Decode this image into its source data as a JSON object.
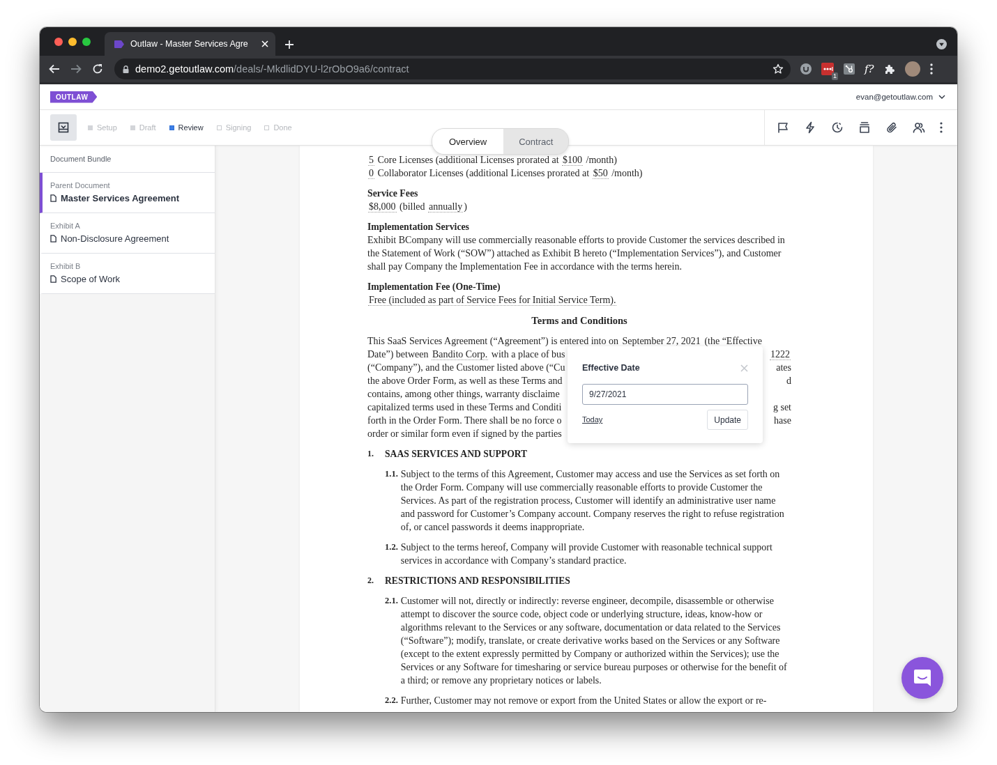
{
  "browser": {
    "tab_title": "Outlaw - Master Services Agre",
    "url_host": "demo2.getoutlaw.com",
    "url_path": "/deals/-MkdlidDYU-l2rObO9a6/contract",
    "extension_badge": "1",
    "extension_glyph": "f?"
  },
  "app": {
    "logo": "OUTLAW",
    "user_email": "evan@getoutlaw.com"
  },
  "steps": [
    {
      "label": "Setup",
      "completed": true,
      "selected": false
    },
    {
      "label": "Draft",
      "completed": true,
      "selected": false
    },
    {
      "label": "Review",
      "completed": false,
      "selected": true
    },
    {
      "label": "Signing",
      "completed": false,
      "selected": false
    },
    {
      "label": "Done",
      "completed": false,
      "selected": false
    }
  ],
  "view_tabs": [
    {
      "label": "Overview",
      "selected": true
    },
    {
      "label": "Contract",
      "selected": false
    }
  ],
  "sidebar": {
    "title": "Document Bundle",
    "items": [
      {
        "label": "Parent Document",
        "title": "Master Services Agreement",
        "selected": true
      },
      {
        "label": "Exhibit A",
        "title": "Non-Disclosure Agreement",
        "selected": false
      },
      {
        "label": "Exhibit B",
        "title": "Scope of Work",
        "selected": false
      }
    ]
  },
  "document": {
    "blocks": [
      {
        "kind": "lines",
        "lines": [
          [
            {
              "text": "5",
              "variable": true
            },
            {
              "text": " Core Licenses (additional Licenses prorated at ",
              "variable": false
            },
            {
              "text": "$100",
              "variable": true
            },
            {
              "text": " /month)",
              "variable": false
            }
          ],
          [
            {
              "text": "0",
              "variable": true
            },
            {
              "text": " Collaborator Licenses (additional Licenses prorated at ",
              "variable": false
            },
            {
              "text": "$50",
              "variable": true
            },
            {
              "text": " /month)",
              "variable": false
            }
          ]
        ]
      },
      {
        "kind": "heading",
        "text": "Service Fees"
      },
      {
        "kind": "lines",
        "lines": [
          [
            {
              "text": "$8,000",
              "variable": true
            },
            {
              "text": " (billed ",
              "variable": false
            },
            {
              "text": "annually",
              "variable": true
            },
            {
              "text": ")",
              "variable": false
            }
          ]
        ]
      },
      {
        "kind": "heading",
        "text": "Implementation Services"
      },
      {
        "kind": "paragraph",
        "text": "Exhibit BCompany will use commercially reasonable efforts to provide Customer the services described in the Statement of Work (“SOW”) attached as Exhibit B hereto (“Implementation Services”), and Customer shall pay Company the Implementation Fee in accordance with the terms herein."
      },
      {
        "kind": "heading",
        "text": "Implementation Fee (One-Time)"
      },
      {
        "kind": "lines",
        "lines": [
          [
            {
              "text": "Free (included as part of Service Fees for Initial Service Term).",
              "variable": true
            }
          ]
        ]
      },
      {
        "kind": "title",
        "text": "Terms and Conditions"
      },
      {
        "kind": "split_paragraph",
        "lines": [
          {
            "left": [
              {
                "text": "This SaaS Services Agreement (“Agreement”) is entered into on ",
                "variable": false
              },
              {
                "text": "September 27, 2021",
                "variable": true
              },
              {
                "text": " (the “Effective",
                "variable": false
              }
            ]
          },
          {
            "left": [
              {
                "text": "Date”) between ",
                "variable": false
              },
              {
                "text": "Bandito Corp.",
                "variable": true
              },
              {
                "text": " with a place of bus",
                "variable": false
              }
            ],
            "right": [
              {
                "text": "1222",
                "variable": true
              }
            ]
          },
          {
            "left": [
              {
                "text": "(“Company”), and the Customer listed above (“Cu",
                "variable": false
              }
            ],
            "right": [
              {
                "text": "ates",
                "variable": false
              }
            ]
          },
          {
            "left": [
              {
                "text": "the above Order Form, as well as these Terms and",
                "variable": false
              }
            ],
            "right": [
              {
                "text": "d",
                "variable": false
              }
            ]
          },
          {
            "left": [
              {
                "text": "contains, among other things, warranty disclaime",
                "variable": false
              }
            ]
          },
          {
            "left": [
              {
                "text": "capitalized terms used in these Terms and Conditi",
                "variable": false
              }
            ],
            "right": [
              {
                "text": "g set",
                "variable": false
              }
            ]
          },
          {
            "left": [
              {
                "text": "forth in the Order Form. There shall be no force o",
                "variable": false
              }
            ],
            "right": [
              {
                "text": "hase",
                "variable": false
              }
            ]
          },
          {
            "left": [
              {
                "text": "order or similar form even if signed by the parties",
                "variable": false
              }
            ]
          }
        ]
      },
      {
        "kind": "section",
        "number": "1.",
        "text": "SAAS SERVICES AND SUPPORT"
      },
      {
        "kind": "clause",
        "number": "1.1.",
        "text": "Subject to the terms of this Agreement, Customer may access and use the Services as set forth on the Order Form. Company will use commercially reasonable efforts to provide Customer the Services. As part of the registration process, Customer will identify an administrative user name and password for Customer’s Company account. Company reserves the right to refuse registration of, or cancel passwords it deems inappropriate."
      },
      {
        "kind": "clause",
        "number": "1.2.",
        "text": "Subject to the terms hereof, Company will provide Customer with reasonable technical support services in accordance with Company’s standard practice."
      },
      {
        "kind": "section",
        "number": "2.",
        "text": "RESTRICTIONS AND RESPONSIBILITIES"
      },
      {
        "kind": "clause",
        "number": "2.1.",
        "text": "Customer will not, directly or indirectly: reverse engineer, decompile, disassemble or otherwise attempt to discover the source code, object code or underlying structure, ideas, know-how or algorithms relevant to the Services or any software, documentation or data related to the Services (“Software”); modify, translate, or create derivative works based on the Services or any Software (except to the extent expressly permitted by Company or authorized within the Services); use the Services or any Software for timesharing or service bureau purposes or otherwise for the benefit of a third; or remove any proprietary notices or labels."
      },
      {
        "kind": "clause",
        "number": "2.2.",
        "text": "Further, Customer may not remove or export from the United States or allow the export or re-"
      }
    ]
  },
  "date_popover": {
    "title": "Effective Date",
    "value": "9/27/2021",
    "link": "Today",
    "button": "Update"
  }
}
